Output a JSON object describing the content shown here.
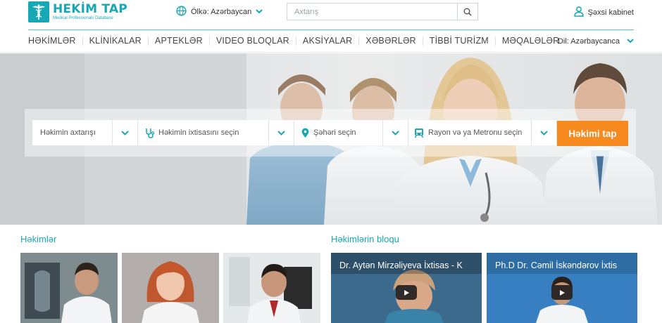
{
  "brand": {
    "title": "HEKİM TAP",
    "subtitle": "Medical Professionals Database",
    "accent": "#17a8b5",
    "cta_color": "#f78a1e"
  },
  "header": {
    "country_label": "Ölkə: Azərbaycan",
    "search_placeholder": "Axtarış",
    "cabinet_label": "Şəxsi kabinet",
    "icons": [
      "globe-icon",
      "chevron-down-icon",
      "search-icon",
      "user-icon"
    ]
  },
  "nav": {
    "items": [
      "HƏKİMLƏR",
      "KLİNİKALAR",
      "APTEKLƏR",
      "VIDEO BLOQLAR",
      "AKSİYALAR",
      "XƏBƏRLƏR",
      "TİBBİ TURİZM",
      "MƏQALƏLƏR"
    ],
    "language_label": "Dil: Azərbaycanca"
  },
  "finder": {
    "doctor_search": "Həkimin axtarışı",
    "specialty": "Həkimin ixtisasını seçin",
    "city": "Şəhəri seçin",
    "district": "Rayon və ya Metronu seçin",
    "submit": "Həkimi tap",
    "icons": [
      "stethoscope-icon",
      "location-pin-icon",
      "metro-train-icon",
      "chevron-down-icon"
    ]
  },
  "doctors": {
    "title": "Həkimlər"
  },
  "blog": {
    "title": "Həkimlərin bloqu",
    "videos": [
      {
        "title": "Dr. Aytən Mirzəliyeva İxtisas - K"
      },
      {
        "title": "Ph.D Dr. Cəmil İskəndərov İxtis"
      }
    ]
  }
}
